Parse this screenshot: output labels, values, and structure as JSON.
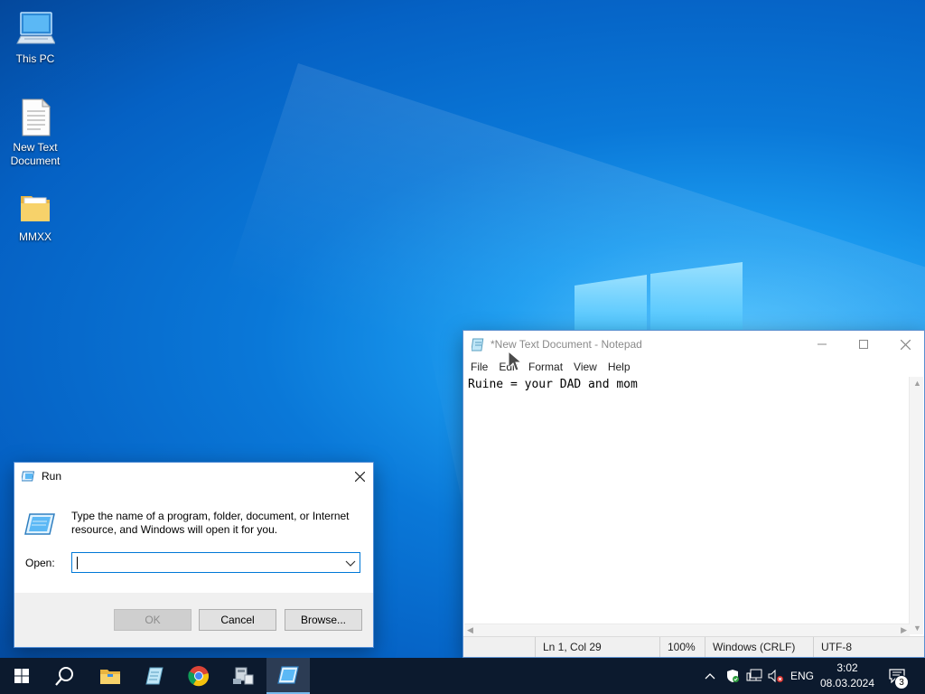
{
  "desktop": {
    "icons": [
      {
        "label": "This PC",
        "icon": "computer-icon"
      },
      {
        "label": "New Text\nDocument",
        "icon": "text-document-icon"
      },
      {
        "label": "MMXX",
        "icon": "folder-icon"
      }
    ]
  },
  "notepad": {
    "title": "*New Text Document - Notepad",
    "menu": [
      "File",
      "Edit",
      "Format",
      "View",
      "Help"
    ],
    "content": "Ruine = your DAD and mom",
    "status": {
      "position": "Ln 1, Col 29",
      "zoom": "100%",
      "line_ending": "Windows (CRLF)",
      "encoding": "UTF-8"
    }
  },
  "run": {
    "title": "Run",
    "description": "Type the name of a program, folder, document, or Internet resource, and Windows will open it for you.",
    "open_label": "Open:",
    "open_value": "",
    "buttons": {
      "ok": "OK",
      "cancel": "Cancel",
      "browse": "Browse..."
    }
  },
  "taskbar": {
    "apps": [
      "start-icon",
      "search-icon",
      "file-explorer-icon",
      "notepad-icon",
      "chrome-icon",
      "network-tool-icon",
      "run-icon"
    ],
    "tray": {
      "language": "ENG",
      "time": "3:02",
      "date": "08.03.2024",
      "notifications": "3"
    }
  },
  "colors": {
    "accent": "#0078d7",
    "taskbar": "#0c1a2e",
    "desktop": "#0a78d8"
  }
}
